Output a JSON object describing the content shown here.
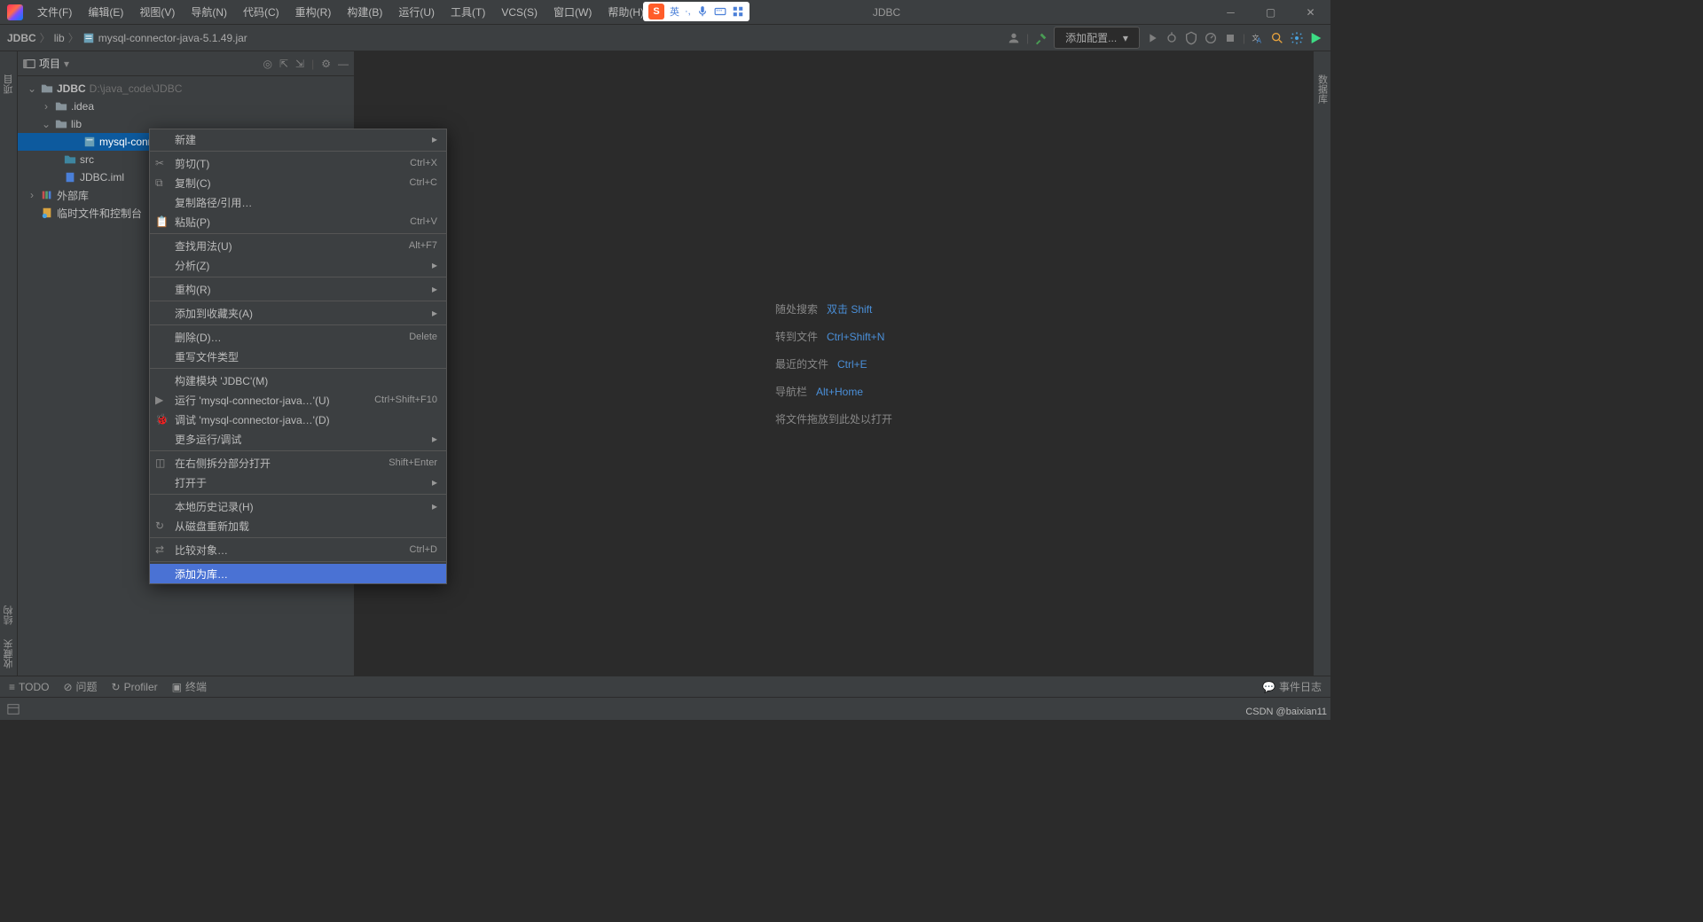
{
  "menubar": [
    "文件(F)",
    "编辑(E)",
    "视图(V)",
    "导航(N)",
    "代码(C)",
    "重构(R)",
    "构建(B)",
    "运行(U)",
    "工具(T)",
    "VCS(S)",
    "窗口(W)",
    "帮助(H)"
  ],
  "title": "JDBC",
  "ime": {
    "lang": "英"
  },
  "breadcrumb": {
    "items": [
      "JDBC",
      "lib",
      "mysql-connector-java-5.1.49.jar"
    ]
  },
  "config_button": "添加配置...",
  "project": {
    "label": "项目",
    "root": {
      "name": "JDBC",
      "path": "D:\\java_code\\JDBC"
    },
    "tree": {
      "idea": ".idea",
      "lib": "lib",
      "jar": "mysql-conne",
      "jar_full": "mysql-connector-java-5.1.49.jar",
      "src": "src",
      "iml": "JDBC.iml",
      "external": "外部库",
      "scratch": "临时文件和控制台"
    }
  },
  "context_menu": [
    {
      "label": "新建",
      "submenu": true
    },
    {
      "sep": true
    },
    {
      "label": "剪切(T)",
      "shortcut": "Ctrl+X",
      "icon": "cut"
    },
    {
      "label": "复制(C)",
      "shortcut": "Ctrl+C",
      "icon": "copy"
    },
    {
      "label": "复制路径/引用…"
    },
    {
      "label": "粘贴(P)",
      "shortcut": "Ctrl+V",
      "icon": "paste"
    },
    {
      "sep": true
    },
    {
      "label": "查找用法(U)",
      "shortcut": "Alt+F7"
    },
    {
      "label": "分析(Z)",
      "submenu": true
    },
    {
      "sep": true
    },
    {
      "label": "重构(R)",
      "submenu": true
    },
    {
      "sep": true
    },
    {
      "label": "添加到收藏夹(A)",
      "submenu": true
    },
    {
      "sep": true
    },
    {
      "label": "删除(D)…",
      "shortcut": "Delete"
    },
    {
      "label": "重写文件类型"
    },
    {
      "sep": true
    },
    {
      "label": "构建模块 'JDBC'(M)"
    },
    {
      "label": "运行 'mysql-connector-java…'(U)",
      "shortcut": "Ctrl+Shift+F10",
      "icon": "run"
    },
    {
      "label": "调试 'mysql-connector-java…'(D)",
      "icon": "debug"
    },
    {
      "label": "更多运行/调试",
      "submenu": true
    },
    {
      "sep": true
    },
    {
      "label": "在右侧拆分部分打开",
      "shortcut": "Shift+Enter",
      "icon": "split"
    },
    {
      "label": "打开于",
      "submenu": true
    },
    {
      "sep": true
    },
    {
      "label": "本地历史记录(H)",
      "submenu": true
    },
    {
      "label": "从磁盘重新加载",
      "icon": "reload"
    },
    {
      "sep": true
    },
    {
      "label": "比较对象…",
      "shortcut": "Ctrl+D",
      "icon": "diff"
    },
    {
      "sep": true
    },
    {
      "label": "添加为库…",
      "highlighted": true
    }
  ],
  "welcome": [
    {
      "text": "随处搜索",
      "key": "双击 Shift"
    },
    {
      "text": "转到文件",
      "key": "Ctrl+Shift+N"
    },
    {
      "text": "最近的文件",
      "key": "Ctrl+E"
    },
    {
      "text": "导航栏",
      "key": "Alt+Home"
    },
    {
      "text": "将文件拖放到此处以打开",
      "key": ""
    }
  ],
  "status": {
    "todo": "TODO",
    "problems": "问题",
    "profiler": "Profiler",
    "terminal": "终端",
    "event_log": "事件日志"
  },
  "left_gutter": [
    "项目",
    "结构",
    "收藏夹"
  ],
  "right_gutter": [
    "数据库"
  ],
  "watermark": "CSDN @baixian11"
}
